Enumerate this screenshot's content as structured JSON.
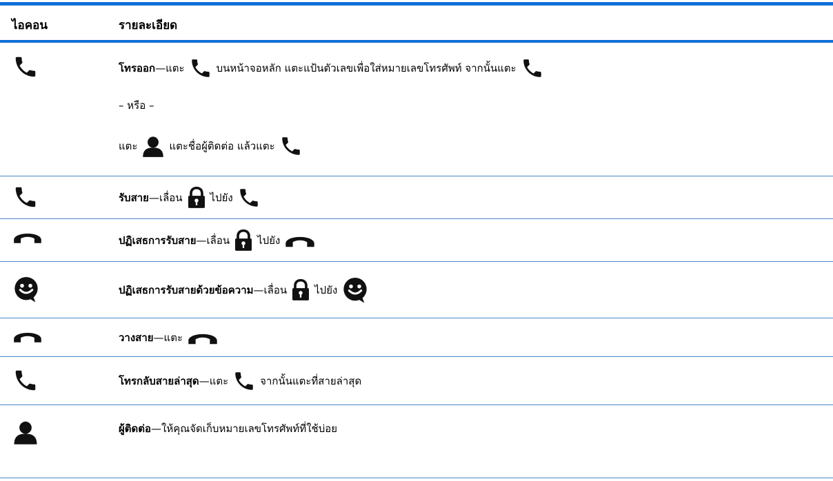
{
  "header": {
    "icon": "ไอคอน",
    "description": "รายละเอียด"
  },
  "rows": [
    {
      "icon": "phone-icon",
      "title": "โทรออก",
      "line1_a": "—แตะ",
      "line1_b": "บนหน้าจอหลัก แตะแป้นตัวเลขเพื่อใส่หมายเลขโทรศัพท์ จากนั้นแตะ",
      "or": "– หรือ –",
      "line3_a": "แตะ",
      "line3_b": "แตะชื่อผู้ติดต่อ แล้วแตะ"
    },
    {
      "icon": "phone-icon",
      "title": "รับสาย",
      "a": "—เลื่อน",
      "b": "ไปยัง"
    },
    {
      "icon": "hang-up-icon",
      "title": "ปฏิเสธการรับสาย",
      "a": "—เลื่อน",
      "b": "ไปยัง"
    },
    {
      "icon": "message-icon",
      "title": "ปฏิเสธการรับสายด้วยข้อความ",
      "a": "—เลื่อน",
      "b": "ไปยัง"
    },
    {
      "icon": "hang-up-icon",
      "title": "วางสาย",
      "a": "—แตะ"
    },
    {
      "icon": "phone-icon",
      "title": "โทรกลับสายล่าสุด",
      "a": "—แตะ",
      "b": "จากนั้นแตะที่สายล่าสุด"
    },
    {
      "icon": "contact-icon",
      "title": "ผู้ติดต่อ",
      "a": "—ให้คุณจัดเก็บหมายเลขโทรศัพท์ที่ใช้บ่อย"
    }
  ],
  "colors": {
    "accent": "#0d6fd6",
    "rule": "#4a86c5"
  }
}
